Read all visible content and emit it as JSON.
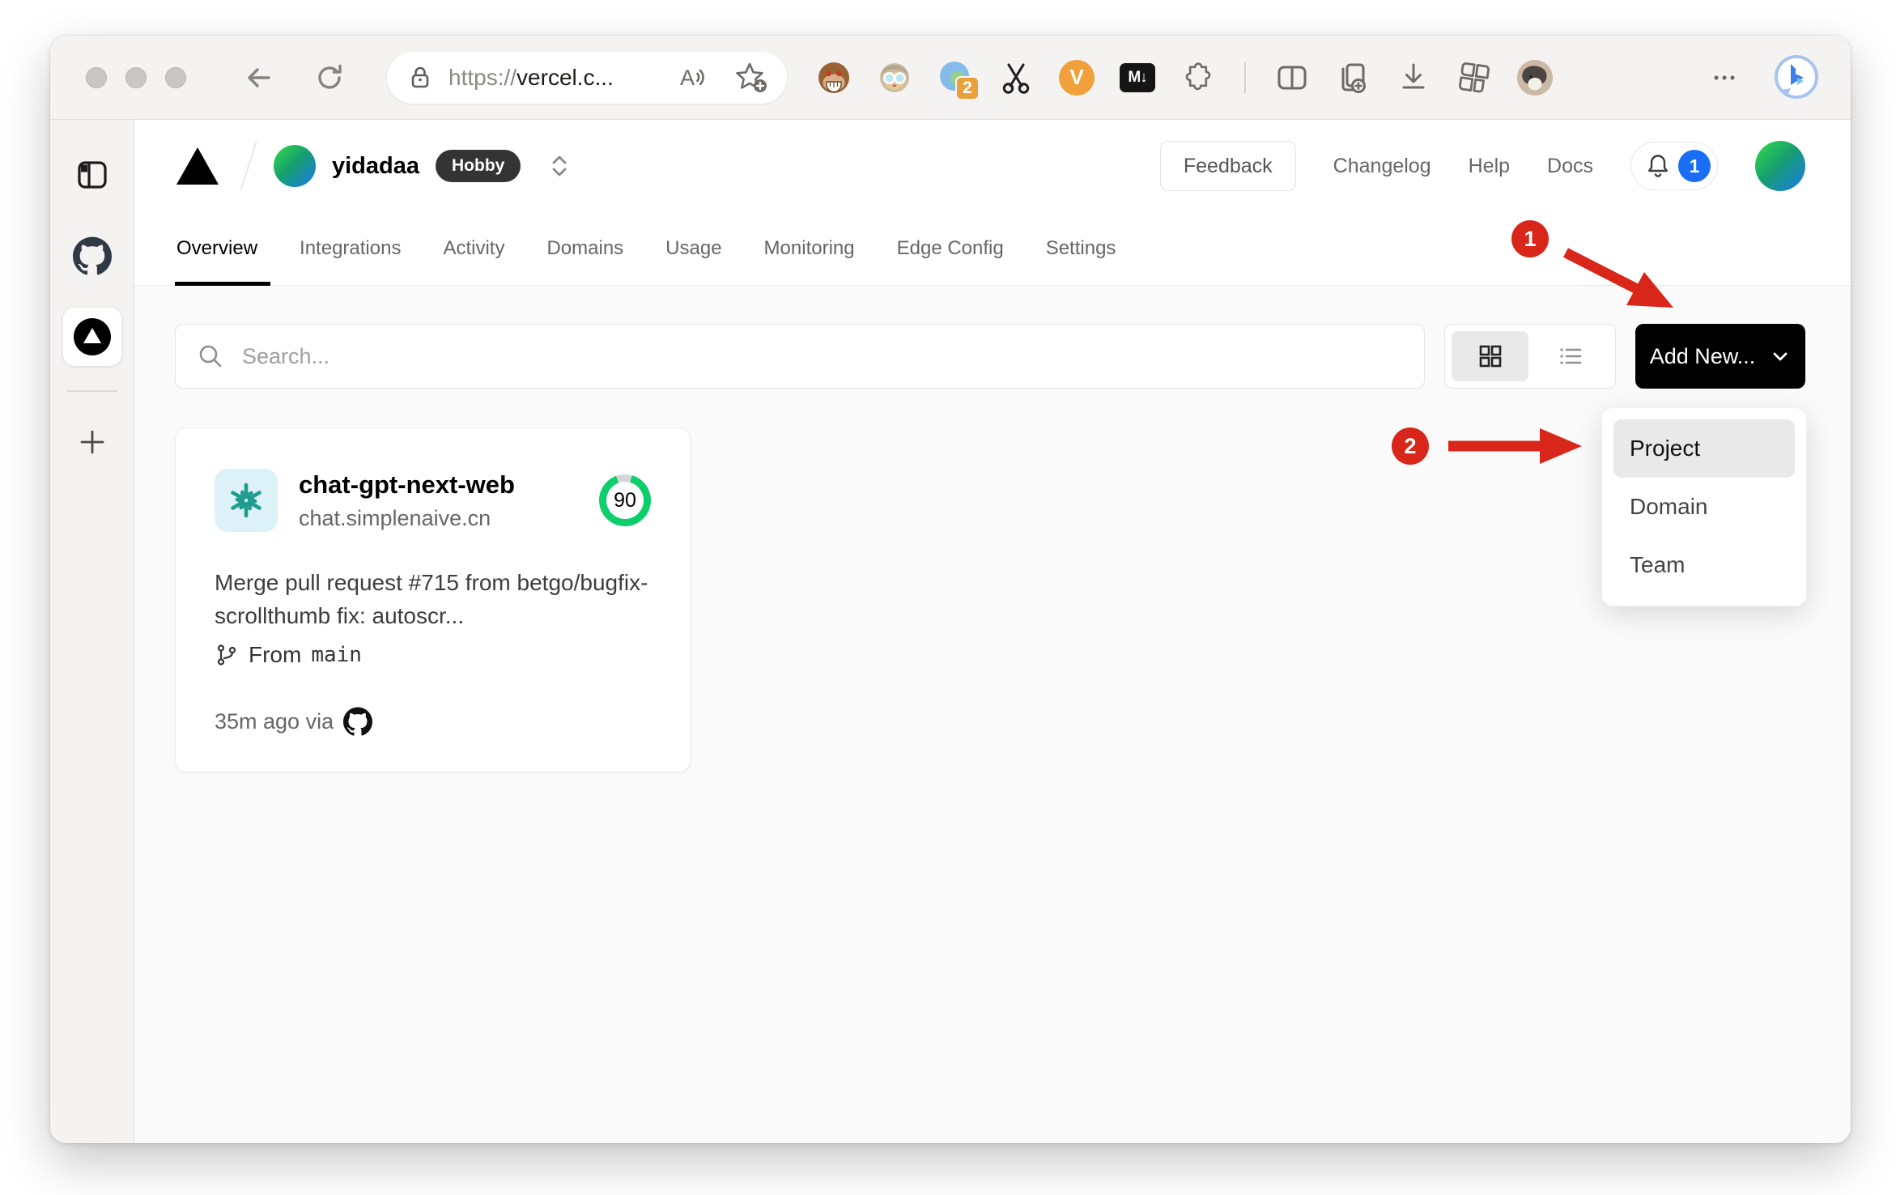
{
  "browser": {
    "url_scheme": "https://",
    "url_host": "vercel.c...",
    "extensions_badge": "2",
    "markdown_badge": "M↓",
    "v_badge": "V"
  },
  "vercel_header": {
    "team_name": "yidadaa",
    "plan_badge": "Hobby",
    "feedback_label": "Feedback",
    "links": [
      {
        "label": "Changelog"
      },
      {
        "label": "Help"
      },
      {
        "label": "Docs"
      }
    ],
    "notification_count": "1"
  },
  "tabs": [
    {
      "label": "Overview",
      "active": true
    },
    {
      "label": "Integrations",
      "active": false
    },
    {
      "label": "Activity",
      "active": false
    },
    {
      "label": "Domains",
      "active": false
    },
    {
      "label": "Usage",
      "active": false
    },
    {
      "label": "Monitoring",
      "active": false
    },
    {
      "label": "Edge Config",
      "active": false
    },
    {
      "label": "Settings",
      "active": false
    }
  ],
  "controls": {
    "search_placeholder": "Search...",
    "add_new_label": "Add New..."
  },
  "dropdown": {
    "items": [
      {
        "label": "Project",
        "highlighted": true
      },
      {
        "label": "Domain",
        "highlighted": false
      },
      {
        "label": "Team",
        "highlighted": false
      }
    ]
  },
  "card": {
    "name": "chat-gpt-next-web",
    "domain": "chat.simplenaive.cn",
    "score": "90",
    "commit_message": "Merge pull request #715 from betgo/bugfix-scrollthumb fix: autoscr...",
    "branch_prefix": "From",
    "branch_name": "main",
    "deployed_meta": "35m ago via"
  },
  "annotations": {
    "step1": "1",
    "step2": "2"
  },
  "colors": {
    "accent_red": "#d9261a",
    "notification_blue": "#1a6ef5",
    "score_green": "#0cce6b",
    "brand_black": "#000000"
  }
}
